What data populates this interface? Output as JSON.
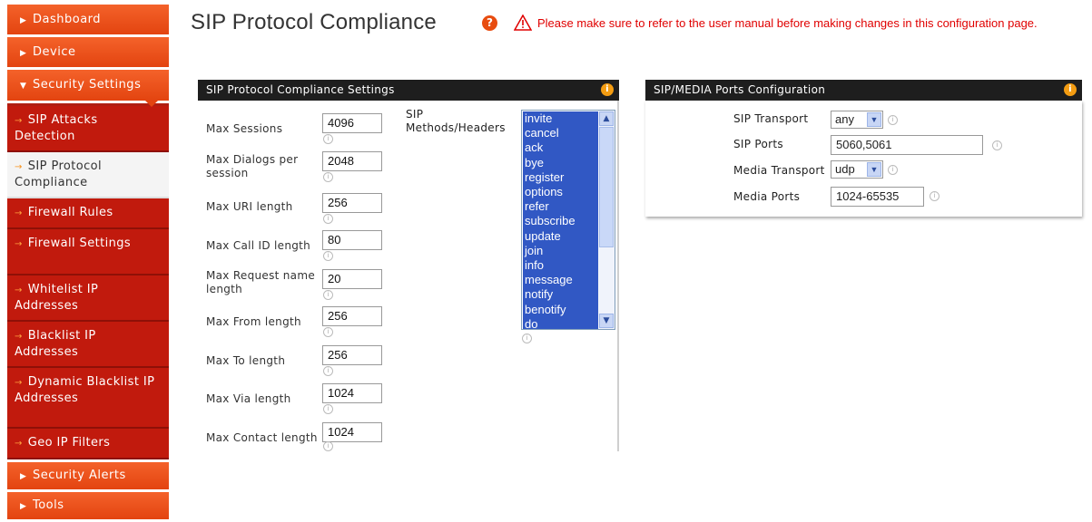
{
  "sidebar": {
    "top_items": [
      "Dashboard",
      "Device",
      "Security Settings"
    ],
    "security_sub_items": [
      "SIP Attacks Detection",
      "SIP Protocol Compliance",
      "Firewall Rules",
      "Firewall Settings",
      "Whitelist IP Addresses",
      "Blacklist IP Addresses",
      "Dynamic Blacklist IP Addresses",
      "Geo IP Filters"
    ],
    "bottom_items": [
      "Security Alerts",
      "Tools"
    ],
    "selected": "SIP Protocol Compliance"
  },
  "header": {
    "title": "SIP Protocol Compliance",
    "help_icon": "?",
    "warning": "Please make sure to refer to the user manual before making changes in this configuration page."
  },
  "compliance_panel": {
    "title": "SIP Protocol Compliance Settings",
    "fields": [
      {
        "label": "Max Sessions",
        "value": "4096"
      },
      {
        "label": "Max Dialogs per session",
        "value": "2048"
      },
      {
        "label": "Max URI length",
        "value": "256"
      },
      {
        "label": "Max Call ID length",
        "value": "80"
      },
      {
        "label": "Max Request name length",
        "value": "20"
      },
      {
        "label": "Max From length",
        "value": "256"
      },
      {
        "label": "Max To length",
        "value": "256"
      },
      {
        "label": "Max Via length",
        "value": "1024"
      },
      {
        "label": "Max Contact length",
        "value": "1024"
      }
    ],
    "methods_label": "SIP Methods/Headers",
    "methods": [
      "invite",
      "cancel",
      "ack",
      "bye",
      "register",
      "options",
      "refer",
      "subscribe",
      "update",
      "join",
      "info",
      "message",
      "notify",
      "benotify",
      "do"
    ]
  },
  "ports_panel": {
    "title": "SIP/MEDIA Ports Configuration",
    "sip_transport_label": "SIP Transport",
    "sip_transport_value": "any",
    "sip_ports_label": "SIP Ports",
    "sip_ports_value": "5060,5061",
    "media_transport_label": "Media Transport",
    "media_transport_value": "udp",
    "media_ports_label": "Media Ports",
    "media_ports_value": "1024-65535"
  },
  "colors": {
    "nav_orange": "#e34410",
    "nav_red": "#c11a0d",
    "warning_red": "#e00000",
    "list_selection": "#3158c4"
  }
}
